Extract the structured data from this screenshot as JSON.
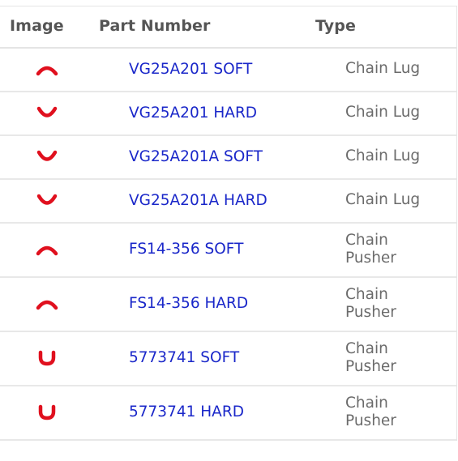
{
  "table": {
    "headers": {
      "image": "Image",
      "part_number": "Part Number",
      "type": "Type"
    },
    "rows": [
      {
        "part_number": "VG25A201 SOFT",
        "type": "Chain Lug",
        "icon": "arch-up-red-icon"
      },
      {
        "part_number": "VG25A201 HARD",
        "type": "Chain Lug",
        "icon": "arch-down-red-icon"
      },
      {
        "part_number": "VG25A201A SOFT",
        "type": "Chain Lug",
        "icon": "arch-down-red-icon"
      },
      {
        "part_number": "VG25A201A HARD",
        "type": "Chain Lug",
        "icon": "arch-down-red-icon"
      },
      {
        "part_number": "FS14-356 SOFT",
        "type": "Chain Pusher",
        "icon": "arch-up-red-icon"
      },
      {
        "part_number": "FS14-356 HARD",
        "type": "Chain Pusher",
        "icon": "arch-up-red-icon"
      },
      {
        "part_number": "5773741 SOFT",
        "type": "Chain Pusher",
        "icon": "u-shape-red-icon"
      },
      {
        "part_number": "5773741 HARD",
        "type": "Chain Pusher",
        "icon": "u-shape-red-icon"
      }
    ],
    "colors": {
      "link": "#1a27c9",
      "part_image_red": "#e0101e",
      "header_text": "#555555",
      "type_text": "#6b6b6b"
    }
  }
}
